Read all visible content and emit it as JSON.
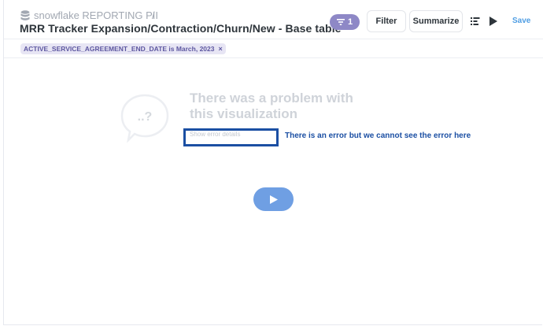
{
  "header": {
    "database_name": "snowflake REPORTING PII",
    "separator": "/",
    "title": "MRR Tracker Expansion/Contraction/Churn/New - Base table"
  },
  "toolbar": {
    "filter_count": "1",
    "filter_label": "Filter",
    "summarize_label": "Summarize",
    "save_label": "Save"
  },
  "filters": [
    {
      "label": "ACTIVE_SERVICE_AGREEMENT_END_DATE is March, 2023",
      "remove": "×"
    }
  ],
  "error": {
    "title": "There was a problem with this visualization",
    "details_link": "Show error details",
    "bubble_text": "..?"
  },
  "annotation": {
    "text": "There is an error but we cannot see the error here"
  },
  "colors": {
    "accent": "#509ee3",
    "filter_purple": "#8e88c6",
    "annotation_blue": "#1b4fa3",
    "run_button": "#6f9fe3"
  }
}
